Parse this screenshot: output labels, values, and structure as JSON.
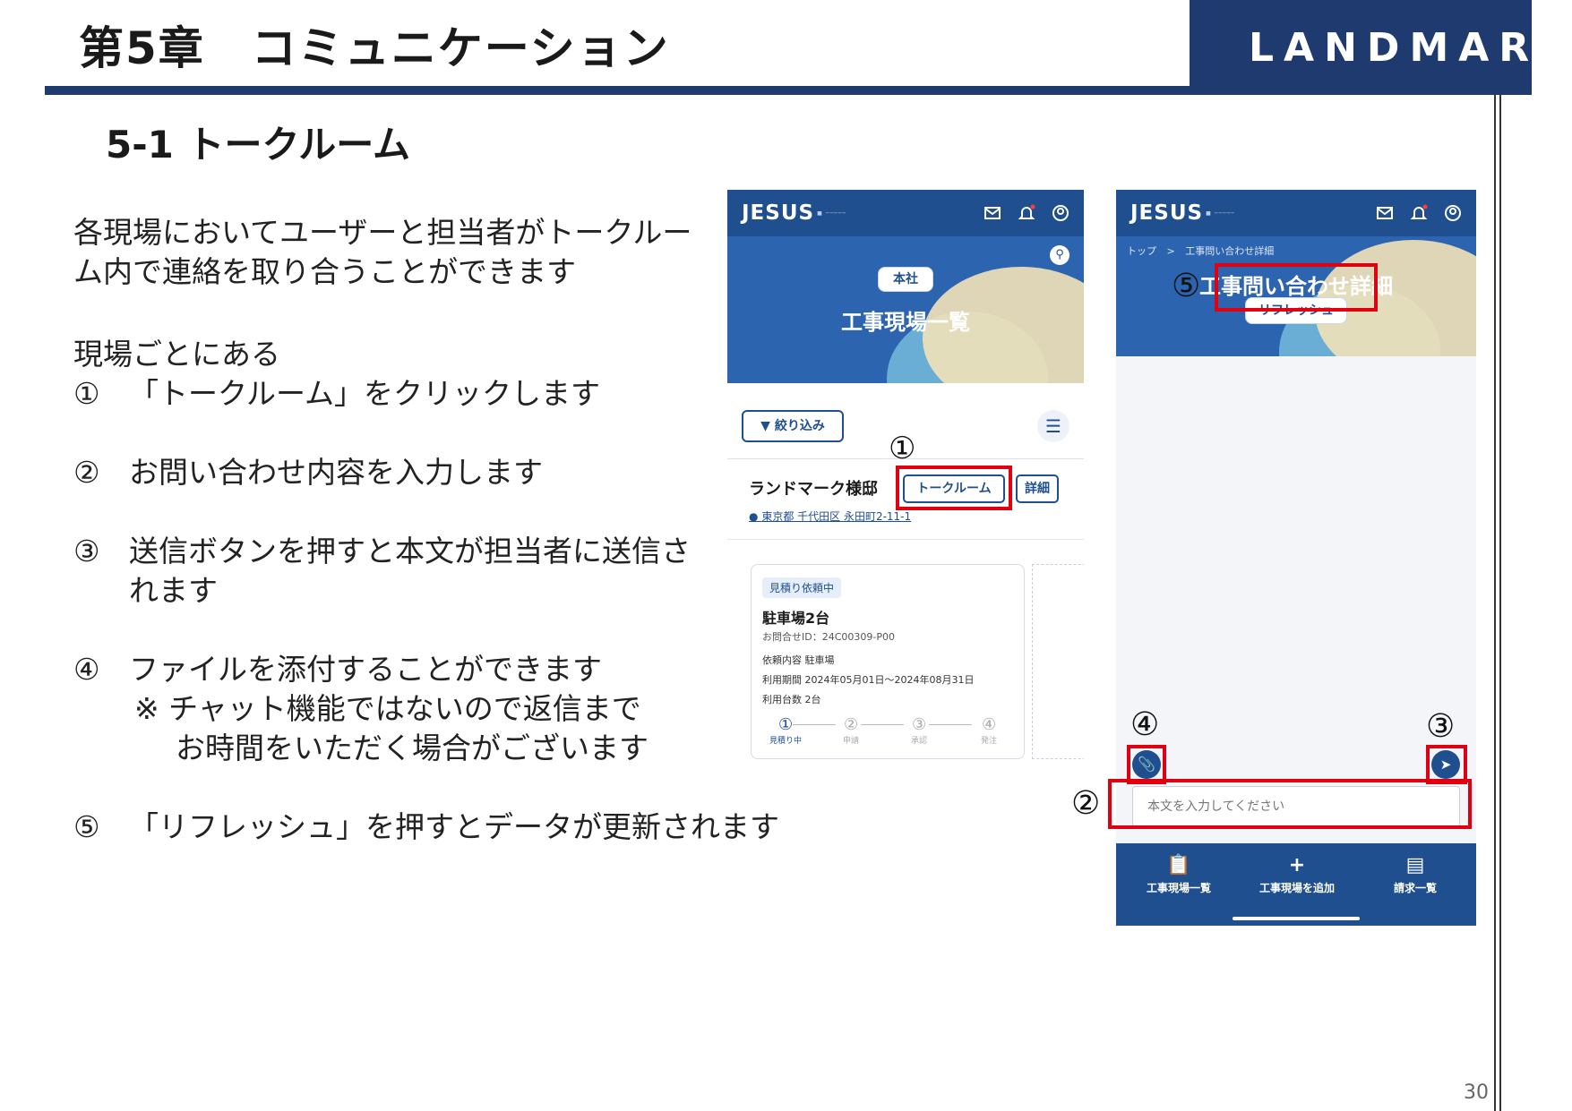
{
  "header": {
    "chapter_title": "第5章　コミュニケーション",
    "logo_text": "LANDMARK",
    "section_title": "5-1 トークルーム"
  },
  "body": {
    "intro_line1": "各現場においてユーザーと担当者がトークルー",
    "intro_line2": "ム内で連絡を取り合うことができます",
    "lead": "現場ごとにある",
    "items": [
      {
        "num": "①",
        "text": "「トークルーム」をクリックします"
      },
      {
        "num": "②",
        "text": "お問い合わせ内容を入力します"
      },
      {
        "num": "③",
        "text": "送信ボタンを押すと本文が担当者に送信さ",
        "text2": "れます"
      },
      {
        "num": "④",
        "text": "ファイルを添付することができます",
        "note1": "※ チャット機能ではないので返信まで",
        "note2": "お時間をいただく場合がございます"
      },
      {
        "num": "⑤",
        "text": "「リフレッシュ」を押すとデータが更新されます"
      }
    ]
  },
  "screen1": {
    "brand": "JESUS",
    "company_pill": "本社",
    "page_title": "工事現場一覧",
    "filter_label": "絞り込み",
    "site_name": "ランドマーク様邸",
    "talkroom_button": "トークルーム",
    "detail_button": "詳細",
    "address": "東京都 千代田区 永田町2-11-1",
    "callout": "①",
    "card": {
      "badge": "見積り依頼中",
      "title": "駐車場2台",
      "inquiry_id": "お問合せID：24C00309-P00",
      "request_content": "依頼内容 駐車場",
      "period": "利用期間 2024年05月01日〜2024年08月31日",
      "count": "利用台数 2台",
      "steps": [
        {
          "num": "①",
          "label": "見積り中"
        },
        {
          "num": "②",
          "label": "申請"
        },
        {
          "num": "③",
          "label": "承認"
        },
        {
          "num": "④",
          "label": "発注"
        }
      ]
    }
  },
  "screen2": {
    "brand": "JESUS",
    "breadcrumb_top": "トップ",
    "breadcrumb_sep": ">",
    "breadcrumb_current": "工事問い合わせ詳細",
    "page_title": "工事問い合わせ詳細",
    "refresh_button": "リフレッシュ",
    "message_placeholder": "本文を入力してください",
    "callouts": {
      "c2": "②",
      "c3": "③",
      "c4": "④",
      "c5": "⑤"
    },
    "nav": [
      {
        "icon": "clipboard-icon",
        "label": "工事現場一覧"
      },
      {
        "icon": "plus-icon",
        "label": "工事現場を追加"
      },
      {
        "icon": "list-icon",
        "label": "請求一覧"
      }
    ]
  },
  "page_number": "30",
  "colors": {
    "navy": "#1f3a6e",
    "app_blue": "#1f4f8f",
    "highlight_red": "#e0000f"
  }
}
